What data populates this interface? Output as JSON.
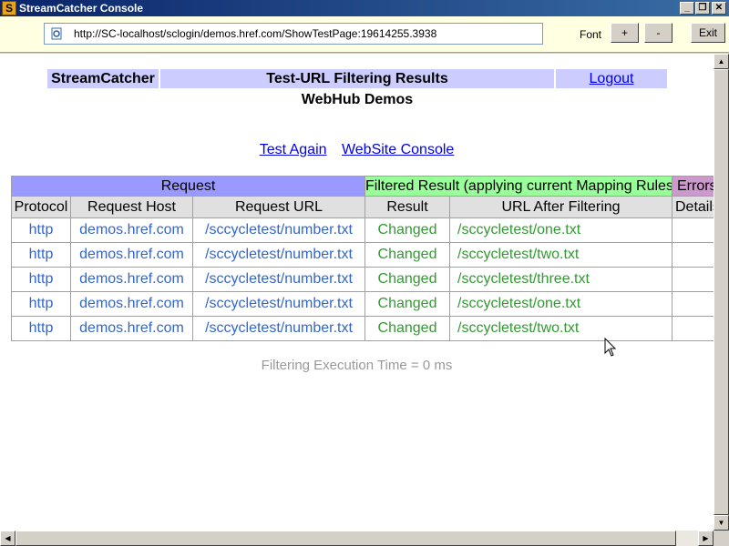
{
  "window": {
    "title": "StreamCatcher Console",
    "app_icon_letter": "S"
  },
  "toolbar": {
    "address": "http://SC-localhost/sclogin/demos.href.com/ShowTestPage:19614255.3938",
    "font_label": "Font",
    "font_plus": "+",
    "font_minus": "-",
    "exit_label": "Exit"
  },
  "header": {
    "brand": "StreamCatcher",
    "title": "Test-URL Filtering Results",
    "logout": "Logout",
    "subtitle": "WebHub Demos"
  },
  "links": {
    "test_again": "Test Again",
    "website_console": "WebSite Console"
  },
  "grid": {
    "groups": {
      "request": "Request",
      "filtered": "Filtered Result (applying current Mapping Rules)",
      "errors": "Errors"
    },
    "columns": [
      "Protocol",
      "Request Host",
      "Request URL",
      "Result",
      "URL After Filtering",
      "Details"
    ],
    "rows": [
      {
        "protocol": "http",
        "host": "demos.href.com",
        "url": "/sccycletest/number.txt",
        "result": "Changed",
        "after": "/sccycletest/one.txt",
        "details": ""
      },
      {
        "protocol": "http",
        "host": "demos.href.com",
        "url": "/sccycletest/number.txt",
        "result": "Changed",
        "after": "/sccycletest/two.txt",
        "details": ""
      },
      {
        "protocol": "http",
        "host": "demos.href.com",
        "url": "/sccycletest/number.txt",
        "result": "Changed",
        "after": "/sccycletest/three.txt",
        "details": ""
      },
      {
        "protocol": "http",
        "host": "demos.href.com",
        "url": "/sccycletest/number.txt",
        "result": "Changed",
        "after": "/sccycletest/one.txt",
        "details": ""
      },
      {
        "protocol": "http",
        "host": "demos.href.com",
        "url": "/sccycletest/number.txt",
        "result": "Changed",
        "after": "/sccycletest/two.txt",
        "details": ""
      }
    ]
  },
  "footer": {
    "exec_time": "Filtering Execution Time = 0 ms"
  },
  "colors": {
    "group_request": "#9999ff",
    "group_filtered": "#99ff99",
    "group_errors": "#cc99cc",
    "header_bg": "#ccccff",
    "link": "#3366cc",
    "changed": "#339933"
  }
}
